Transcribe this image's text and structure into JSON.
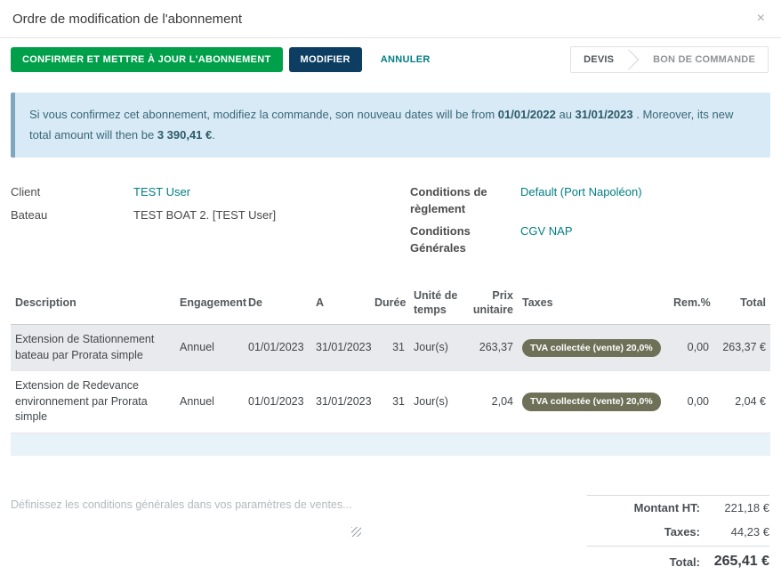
{
  "modal": {
    "title": "Ordre de modification de l'abonnement",
    "close": "×"
  },
  "toolbar": {
    "confirm_label": "CONFIRMER ET METTRE À JOUR L'ABONNEMENT",
    "modify_label": "MODIFIER",
    "cancel_label": "ANNULER",
    "statusbar": [
      {
        "label": "DEVIS",
        "active": true
      },
      {
        "label": "BON DE COMMANDE",
        "active": false
      }
    ]
  },
  "alert": {
    "text_before": "Si vous confirmez cet abonnement, modifiez la commande, son nouveau dates will be from ",
    "date_from": "01/01/2022",
    "text_middle": " au ",
    "date_to": "31/01/2023",
    "text_after": " . Moreover, its new total amount will then be ",
    "amount": "3 390,41 €",
    "text_end": "."
  },
  "fields": {
    "client_label": "Client",
    "client_value": "TEST User",
    "bateau_label": "Bateau",
    "bateau_value": "TEST BOAT 2. [TEST User]",
    "payment_terms_label": "Conditions de règlement",
    "payment_terms_value": "Default (Port Napoléon)",
    "general_conditions_label": "Conditions Générales",
    "general_conditions_value": "CGV NAP"
  },
  "table": {
    "headers": [
      "Description",
      "Engagement",
      "De",
      "A",
      "Durée",
      "Unité de temps",
      "Prix unitaire",
      "Taxes",
      "Rem.%",
      "Total"
    ],
    "rows": [
      {
        "description": "Extension de Stationnement bateau par Prorata simple",
        "engagement": "Annuel",
        "de": "01/01/2023",
        "a": "31/01/2023",
        "duree": "31",
        "unite": "Jour(s)",
        "prix": "263,37",
        "taxes": "TVA collectée (vente) 20,0%",
        "rem": "0,00",
        "total": "263,37 €"
      },
      {
        "description": "Extension de Redevance environnement par Prorata simple",
        "engagement": "Annuel",
        "de": "01/01/2023",
        "a": "31/01/2023",
        "duree": "31",
        "unite": "Jour(s)",
        "prix": "2,04",
        "taxes": "TVA collectée (vente) 20,0%",
        "rem": "0,00",
        "total": "2,04 €"
      }
    ]
  },
  "notes": {
    "placeholder": "Définissez les conditions générales dans vos paramètres de ventes..."
  },
  "totals": {
    "montant_ht_label": "Montant HT:",
    "montant_ht_value": "221,18 €",
    "taxes_label": "Taxes:",
    "taxes_value": "44,23 €",
    "total_label": "Total:",
    "total_value": "265,41 €"
  },
  "colors": {
    "green": "#00a04a",
    "navy": "#0d3e62",
    "link": "#017e84",
    "alert-bg": "#d7eaf5",
    "alert-border": "#7fa8bf",
    "alert-text": "#3a6878",
    "badge": "#6e7158",
    "row-sel": "#e8eaed",
    "row-empty": "#e8f2f9"
  }
}
